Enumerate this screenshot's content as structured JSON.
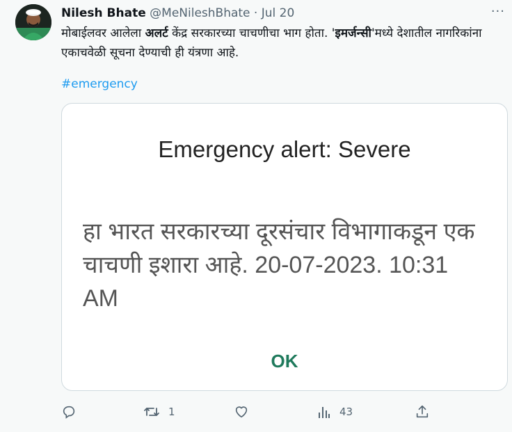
{
  "author": {
    "name": "Nilesh Bhate",
    "handle": "@MeNileshBhate",
    "separator": "·",
    "date": "Jul 20"
  },
  "more_label": "···",
  "tweet": {
    "part1": "मोबाईलवर आलेला ",
    "bold1": "अलर्ट",
    "part2": " केंद्र सरकारच्या चाचणीचा भाग होता. '",
    "bold2": "इमर्जन्सी",
    "part3": "'मध्ये देशातील नागरिकांना एकाचवेळी सूचना देण्याची ही यंत्रणा आहे.",
    "hashtag": "#emergency"
  },
  "alert_card": {
    "title": "Emergency alert: Severe",
    "message": "हा भारत सरकारच्या दूरसंचार विभागाकडून एक चाचणी इशारा आहे. 20-07-2023. 10:31 AM",
    "ok_label": "OK"
  },
  "actions": {
    "reply_icon": "reply-icon",
    "retweet_icon": "retweet-icon",
    "retweet_count": "1",
    "like_icon": "heart-icon",
    "views_icon": "views-icon",
    "views_count": "43",
    "share_icon": "share-icon"
  },
  "colors": {
    "accent": "#1d9bf0",
    "ok_green": "#1f7a5c",
    "muted": "#536471"
  }
}
